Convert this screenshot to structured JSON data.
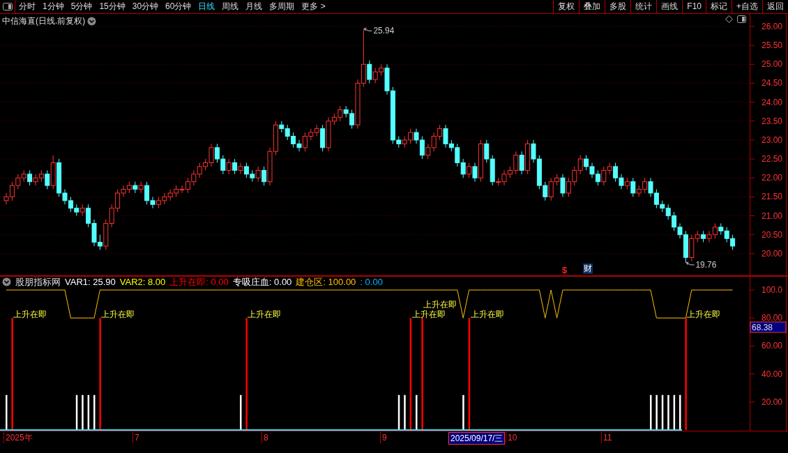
{
  "toolbar": {
    "periods": [
      {
        "label": "分时",
        "selected": false
      },
      {
        "label": "1分钟",
        "selected": false
      },
      {
        "label": "5分钟",
        "selected": false
      },
      {
        "label": "15分钟",
        "selected": false
      },
      {
        "label": "30分钟",
        "selected": false
      },
      {
        "label": "60分钟",
        "selected": false
      },
      {
        "label": "日线",
        "selected": true
      },
      {
        "label": "周线",
        "selected": false
      },
      {
        "label": "月线",
        "selected": false
      },
      {
        "label": "多周期",
        "selected": false
      },
      {
        "label": "更多 >",
        "selected": false
      }
    ],
    "buttons": [
      "复权",
      "叠加",
      "多股",
      "统计",
      "画线",
      "F10",
      "标记",
      "+自选",
      "返回"
    ]
  },
  "price_panel": {
    "title": "中信海直(日线.前复权)",
    "chart_data": {
      "type": "candlestick",
      "grid": true,
      "ylim": [
        19.41,
        26.33
      ],
      "yticks": [
        {
          "value": 26,
          "label": "26.00"
        },
        {
          "value": 25.5,
          "label": "25.50"
        },
        {
          "value": 25,
          "label": "25.00"
        },
        {
          "value": 24.5,
          "label": "24.50"
        },
        {
          "value": 24,
          "label": "24.00"
        },
        {
          "value": 23.5,
          "label": "23.50"
        },
        {
          "value": 23,
          "label": "23.00"
        },
        {
          "value": 22.5,
          "label": "22.50"
        },
        {
          "value": 22,
          "label": "22.00"
        },
        {
          "value": 21.5,
          "label": "21.50"
        },
        {
          "value": 21,
          "label": "21.00"
        },
        {
          "value": 20.5,
          "label": "20.50"
        },
        {
          "value": 20,
          "label": "20.00"
        }
      ],
      "ohlc": [
        [
          21.4,
          21.6,
          21.3,
          21.5
        ],
        [
          21.5,
          21.9,
          21.4,
          21.8
        ],
        [
          21.8,
          22.1,
          21.7,
          22.0
        ],
        [
          22.0,
          22.2,
          21.9,
          22.1
        ],
        [
          22.1,
          22.2,
          21.8,
          21.9
        ],
        [
          21.9,
          22.1,
          21.8,
          22.0
        ],
        [
          22.0,
          22.2,
          21.9,
          22.1
        ],
        [
          22.1,
          22.2,
          21.7,
          21.8
        ],
        [
          21.8,
          22.6,
          21.7,
          22.4
        ],
        [
          22.4,
          22.5,
          21.5,
          21.6
        ],
        [
          21.6,
          21.7,
          21.3,
          21.4
        ],
        [
          21.4,
          21.5,
          21.1,
          21.2
        ],
        [
          21.2,
          21.3,
          21.0,
          21.1
        ],
        [
          21.1,
          21.3,
          21.0,
          21.2
        ],
        [
          21.2,
          21.3,
          20.7,
          20.8
        ],
        [
          20.8,
          20.9,
          20.2,
          20.3
        ],
        [
          20.3,
          20.5,
          20.1,
          20.2
        ],
        [
          20.2,
          20.9,
          20.1,
          20.8
        ],
        [
          20.8,
          21.3,
          20.7,
          21.2
        ],
        [
          21.2,
          21.7,
          21.1,
          21.6
        ],
        [
          21.6,
          21.8,
          21.5,
          21.7
        ],
        [
          21.7,
          21.9,
          21.6,
          21.8
        ],
        [
          21.8,
          21.9,
          21.6,
          21.7
        ],
        [
          21.7,
          21.9,
          21.6,
          21.8
        ],
        [
          21.8,
          21.9,
          21.3,
          21.4
        ],
        [
          21.4,
          21.5,
          21.2,
          21.3
        ],
        [
          21.3,
          21.5,
          21.2,
          21.4
        ],
        [
          21.4,
          21.6,
          21.3,
          21.5
        ],
        [
          21.5,
          21.7,
          21.4,
          21.6
        ],
        [
          21.6,
          21.8,
          21.5,
          21.7
        ],
        [
          21.7,
          21.8,
          21.6,
          21.7
        ],
        [
          21.7,
          22.0,
          21.6,
          21.9
        ],
        [
          21.9,
          22.2,
          21.8,
          22.1
        ],
        [
          22.1,
          22.4,
          22.0,
          22.3
        ],
        [
          22.3,
          22.5,
          22.2,
          22.4
        ],
        [
          22.4,
          22.9,
          22.3,
          22.8
        ],
        [
          22.8,
          22.9,
          22.4,
          22.5
        ],
        [
          22.5,
          22.6,
          22.1,
          22.2
        ],
        [
          22.2,
          22.5,
          22.1,
          22.4
        ],
        [
          22.4,
          22.5,
          22.1,
          22.2
        ],
        [
          22.2,
          22.4,
          22.1,
          22.3
        ],
        [
          22.3,
          22.4,
          22.0,
          22.1
        ],
        [
          22.1,
          22.2,
          21.9,
          22.0
        ],
        [
          22.0,
          22.3,
          21.9,
          22.2
        ],
        [
          22.2,
          22.3,
          21.8,
          21.9
        ],
        [
          21.9,
          22.8,
          21.8,
          22.7
        ],
        [
          22.7,
          23.5,
          22.6,
          23.4
        ],
        [
          23.4,
          23.5,
          23.2,
          23.3
        ],
        [
          23.3,
          23.4,
          23.0,
          23.1
        ],
        [
          23.1,
          23.2,
          22.8,
          22.9
        ],
        [
          22.9,
          23.0,
          22.7,
          22.8
        ],
        [
          22.8,
          23.2,
          22.7,
          23.1
        ],
        [
          23.1,
          23.3,
          23.0,
          23.2
        ],
        [
          23.2,
          23.4,
          23.1,
          23.3
        ],
        [
          23.3,
          23.4,
          22.7,
          22.8
        ],
        [
          22.8,
          23.6,
          22.7,
          23.5
        ],
        [
          23.5,
          23.7,
          23.4,
          23.6
        ],
        [
          23.6,
          23.9,
          23.5,
          23.8
        ],
        [
          23.8,
          23.9,
          23.6,
          23.7
        ],
        [
          23.7,
          23.8,
          23.3,
          23.4
        ],
        [
          23.4,
          24.6,
          23.3,
          24.5
        ],
        [
          24.5,
          25.94,
          24.4,
          25.0
        ],
        [
          25.0,
          25.1,
          24.5,
          24.6
        ],
        [
          24.6,
          24.9,
          24.5,
          24.8
        ],
        [
          24.8,
          25.0,
          24.7,
          24.9
        ],
        [
          24.9,
          25.0,
          24.2,
          24.3
        ],
        [
          24.3,
          24.4,
          22.9,
          23.0
        ],
        [
          23.0,
          23.1,
          22.8,
          22.9
        ],
        [
          22.9,
          23.1,
          22.8,
          23.0
        ],
        [
          23.0,
          23.3,
          22.9,
          23.2
        ],
        [
          23.2,
          23.3,
          22.9,
          23.0
        ],
        [
          23.0,
          23.1,
          22.5,
          22.6
        ],
        [
          22.6,
          22.9,
          22.5,
          22.8
        ],
        [
          22.8,
          23.2,
          22.7,
          23.1
        ],
        [
          23.1,
          23.4,
          23.0,
          23.3
        ],
        [
          23.3,
          23.4,
          22.8,
          22.9
        ],
        [
          22.9,
          23.0,
          22.7,
          22.8
        ],
        [
          22.8,
          22.9,
          22.3,
          22.4
        ],
        [
          22.4,
          22.5,
          22.0,
          22.1
        ],
        [
          22.1,
          22.4,
          22.0,
          22.3
        ],
        [
          22.3,
          22.4,
          21.9,
          22.0
        ],
        [
          22.0,
          23.0,
          21.9,
          22.9
        ],
        [
          22.9,
          23.0,
          22.4,
          22.5
        ],
        [
          22.5,
          22.6,
          21.8,
          21.9
        ],
        [
          21.9,
          22.0,
          21.8,
          21.9
        ],
        [
          21.9,
          22.2,
          21.8,
          22.1
        ],
        [
          22.1,
          22.3,
          22.0,
          22.2
        ],
        [
          22.2,
          22.7,
          22.1,
          22.6
        ],
        [
          22.6,
          22.7,
          22.1,
          22.2
        ],
        [
          22.2,
          23.0,
          22.1,
          22.9
        ],
        [
          22.9,
          23.0,
          22.4,
          22.5
        ],
        [
          22.5,
          22.6,
          21.7,
          21.8
        ],
        [
          21.8,
          21.9,
          21.4,
          21.5
        ],
        [
          21.5,
          22.0,
          21.4,
          21.9
        ],
        [
          21.9,
          22.1,
          21.8,
          22.0
        ],
        [
          22.0,
          22.1,
          21.5,
          21.6
        ],
        [
          21.6,
          22.0,
          21.5,
          21.9
        ],
        [
          21.9,
          22.3,
          21.8,
          22.2
        ],
        [
          22.2,
          22.6,
          22.1,
          22.5
        ],
        [
          22.5,
          22.6,
          22.2,
          22.3
        ],
        [
          22.3,
          22.4,
          22.0,
          22.1
        ],
        [
          22.1,
          22.2,
          21.8,
          21.9
        ],
        [
          21.9,
          22.3,
          21.8,
          22.2
        ],
        [
          22.2,
          22.4,
          22.1,
          22.3
        ],
        [
          22.3,
          22.4,
          21.9,
          22.0
        ],
        [
          22.0,
          22.1,
          21.7,
          21.8
        ],
        [
          21.8,
          22.0,
          21.7,
          21.9
        ],
        [
          21.9,
          22.0,
          21.5,
          21.6
        ],
        [
          21.6,
          21.8,
          21.5,
          21.7
        ],
        [
          21.7,
          22.0,
          21.6,
          21.9
        ],
        [
          21.9,
          22.0,
          21.5,
          21.6
        ],
        [
          21.6,
          21.7,
          21.2,
          21.3
        ],
        [
          21.3,
          21.4,
          21.1,
          21.2
        ],
        [
          21.2,
          21.3,
          20.9,
          21.0
        ],
        [
          21.0,
          21.1,
          20.6,
          20.7
        ],
        [
          20.7,
          20.8,
          20.4,
          20.5
        ],
        [
          20.5,
          20.6,
          19.76,
          19.9
        ],
        [
          19.9,
          20.5,
          19.8,
          20.4
        ],
        [
          20.4,
          20.6,
          20.3,
          20.5
        ],
        [
          20.5,
          20.6,
          20.3,
          20.4
        ],
        [
          20.4,
          20.6,
          20.3,
          20.5
        ],
        [
          20.5,
          20.8,
          20.4,
          20.7
        ],
        [
          20.7,
          20.8,
          20.5,
          20.6
        ],
        [
          20.6,
          20.7,
          20.3,
          20.4
        ],
        [
          20.4,
          20.5,
          20.1,
          20.2
        ]
      ],
      "annotations": [
        "25.94",
        "19.76"
      ]
    },
    "events": [
      {
        "kind": "dollar",
        "text": "$"
      },
      {
        "kind": "finance",
        "text": "财"
      }
    ]
  },
  "indicator_panel": {
    "name": "股朋指标网",
    "values": [
      {
        "text": "VAR1: 25.90",
        "color": "#ffffff"
      },
      {
        "text": "VAR2: 8.00",
        "color": "#ffff00"
      },
      {
        "text": "上升在即: 0.00",
        "color": "#ff0000"
      },
      {
        "text": "专吸庄血: 0.00",
        "color": "#ffffff"
      },
      {
        "text": "建仓区: 100.00",
        "color": "#ffc000"
      },
      {
        "text": ": 0.00",
        "color": "#00b4ff"
      }
    ],
    "cursor_value": "68.38",
    "chart_data": {
      "type": "bar",
      "ylim": [
        0,
        110
      ],
      "yticks": [
        {
          "value": 100,
          "label": "100.0"
        },
        {
          "value": 80,
          "label": "80.00"
        },
        {
          "value": 60,
          "label": "60.00"
        },
        {
          "value": 40,
          "label": "40.00"
        },
        {
          "value": 20,
          "label": "20.00"
        }
      ],
      "series": [
        {
          "type": "line",
          "color": "#ffc000",
          "values": [
            100,
            100,
            100,
            100,
            100,
            100,
            100,
            100,
            100,
            100,
            100,
            80,
            80,
            80,
            80,
            80,
            100,
            100,
            100,
            100,
            100,
            100,
            100,
            100,
            100,
            100,
            100,
            100,
            100,
            100,
            100,
            100,
            100,
            100,
            100,
            100,
            100,
            100,
            100,
            100,
            100,
            100,
            100,
            100,
            100,
            100,
            100,
            100,
            100,
            100,
            100,
            100,
            100,
            100,
            100,
            100,
            100,
            100,
            100,
            100,
            100,
            100,
            100,
            100,
            100,
            100,
            100,
            100,
            100,
            100,
            100,
            100,
            100,
            100,
            100,
            100,
            100,
            100,
            80,
            100,
            100,
            100,
            100,
            100,
            100,
            100,
            100,
            100,
            100,
            100,
            100,
            100,
            80,
            100,
            80,
            100,
            100,
            100,
            100,
            100,
            100,
            100,
            100,
            100,
            100,
            100,
            100,
            100,
            100,
            100,
            100,
            80,
            80,
            80,
            80,
            80,
            80,
            100,
            100,
            100,
            100,
            100,
            100,
            100,
            100
          ]
        },
        {
          "type": "bar",
          "color": "#ffffff",
          "values": [
            25,
            null,
            null,
            null,
            null,
            null,
            null,
            null,
            null,
            null,
            null,
            null,
            25,
            25,
            25,
            25,
            null,
            null,
            null,
            null,
            null,
            null,
            null,
            null,
            null,
            null,
            null,
            null,
            null,
            null,
            null,
            null,
            null,
            null,
            null,
            null,
            null,
            null,
            null,
            null,
            25,
            null,
            null,
            null,
            null,
            null,
            null,
            null,
            null,
            null,
            null,
            null,
            null,
            null,
            null,
            null,
            null,
            null,
            null,
            null,
            null,
            null,
            null,
            null,
            null,
            null,
            null,
            25,
            25,
            null,
            25,
            null,
            null,
            null,
            null,
            null,
            null,
            null,
            25,
            null,
            null,
            null,
            null,
            null,
            null,
            null,
            null,
            null,
            null,
            null,
            null,
            null,
            null,
            null,
            null,
            null,
            null,
            null,
            null,
            null,
            null,
            null,
            null,
            null,
            null,
            null,
            null,
            null,
            null,
            null,
            25,
            25,
            25,
            25,
            25,
            25,
            null,
            null,
            null,
            null,
            null,
            null,
            null,
            null,
            null
          ]
        },
        {
          "type": "bar",
          "color": "#ff0000",
          "values": [
            null,
            80,
            null,
            null,
            null,
            null,
            null,
            null,
            null,
            null,
            null,
            null,
            null,
            null,
            null,
            null,
            80,
            null,
            null,
            null,
            null,
            null,
            null,
            null,
            null,
            null,
            null,
            null,
            null,
            null,
            null,
            null,
            null,
            null,
            null,
            null,
            null,
            null,
            null,
            null,
            null,
            80,
            null,
            null,
            null,
            null,
            null,
            null,
            null,
            null,
            null,
            null,
            null,
            null,
            null,
            null,
            null,
            null,
            null,
            null,
            null,
            null,
            null,
            null,
            null,
            null,
            null,
            null,
            null,
            80,
            null,
            80,
            null,
            null,
            null,
            null,
            null,
            null,
            null,
            80,
            null,
            null,
            null,
            null,
            null,
            null,
            null,
            null,
            null,
            null,
            null,
            null,
            null,
            null,
            null,
            null,
            null,
            null,
            null,
            null,
            null,
            null,
            null,
            null,
            null,
            null,
            null,
            null,
            null,
            null,
            null,
            null,
            null,
            null,
            null,
            null,
            80,
            null,
            null,
            null,
            null,
            null,
            null,
            null,
            null
          ]
        }
      ],
      "annotations": [
        "上升在即",
        "上升在即",
        "上升在即",
        "上升在即",
        "上升在即",
        "上升在即",
        "上升在即"
      ]
    }
  },
  "date_axis": [
    {
      "label": "2025年",
      "selected": false
    },
    {
      "label": "7",
      "selected": false
    },
    {
      "label": "8",
      "selected": false
    },
    {
      "label": "9",
      "selected": false
    },
    {
      "label": "2025/09/17/三",
      "selected": true
    },
    {
      "label": "10",
      "selected": false
    },
    {
      "label": "11",
      "selected": false
    }
  ]
}
